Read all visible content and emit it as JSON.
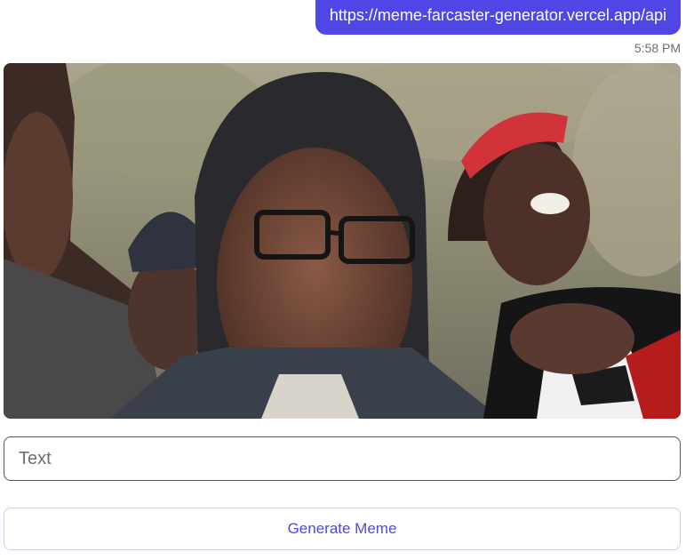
{
  "message": {
    "url": "https://meme-farcaster-generator.vercel.app/api",
    "timestamp": "5:58 PM"
  },
  "frame": {
    "image_description_icon": "meme-frame-image",
    "input": {
      "value": "",
      "placeholder": "Text"
    },
    "button_label": "Generate Meme"
  },
  "colors": {
    "accent": "#5046e5",
    "button_border": "#c9cde8"
  }
}
